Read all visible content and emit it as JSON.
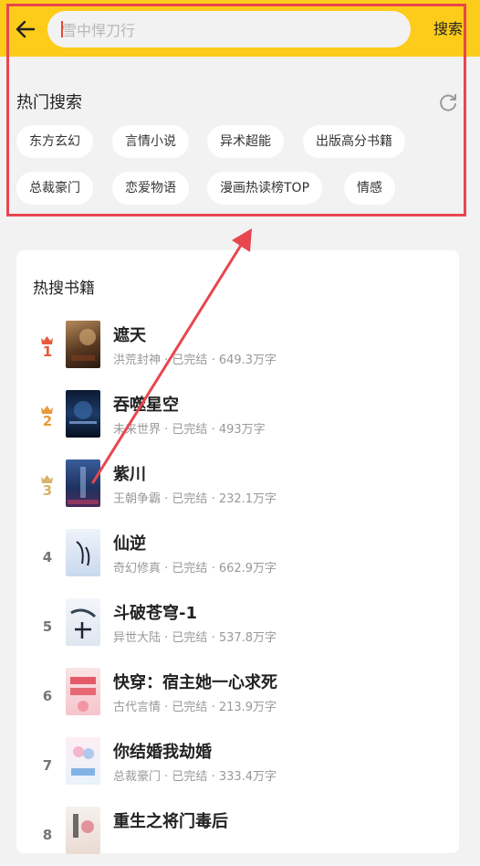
{
  "header": {
    "search_placeholder": "雪中悍刀行",
    "search_button": "搜索"
  },
  "hot_search": {
    "title": "热门搜索",
    "tags": [
      "东方玄幻",
      "言情小说",
      "异术超能",
      "出版高分书籍",
      "总裁豪门",
      "恋爱物语",
      "漫画热读榜TOP",
      "情感"
    ]
  },
  "hot_books": {
    "title": "热搜书籍",
    "books": [
      {
        "rank": "1",
        "title": "遮天",
        "category": "洪荒封神",
        "status": "已完结",
        "words": "649.3万字"
      },
      {
        "rank": "2",
        "title": "吞噬星空",
        "category": "未来世界",
        "status": "已完结",
        "words": "493万字"
      },
      {
        "rank": "3",
        "title": "紫川",
        "category": "王朝争霸",
        "status": "已完结",
        "words": "232.1万字"
      },
      {
        "rank": "4",
        "title": "仙逆",
        "category": "奇幻修真",
        "status": "已完结",
        "words": "662.9万字"
      },
      {
        "rank": "5",
        "title": "斗破苍穹-1",
        "category": "异世大陆",
        "status": "已完结",
        "words": "537.8万字"
      },
      {
        "rank": "6",
        "title": "快穿：宿主她一心求死",
        "category": "古代言情",
        "status": "已完结",
        "words": "213.9万字"
      },
      {
        "rank": "7",
        "title": "你结婚我劫婚",
        "category": "总裁豪门",
        "status": "已完结",
        "words": "333.4万字"
      },
      {
        "rank": "8",
        "title": "重生之将门毒后",
        "category": "",
        "status": "",
        "words": ""
      }
    ]
  },
  "colors": {
    "accent": "#fdcb1a",
    "annotation": "#e8464f",
    "rank1": "#e8593c",
    "rank2": "#e89a3c",
    "rank3": "#d6b36a"
  }
}
